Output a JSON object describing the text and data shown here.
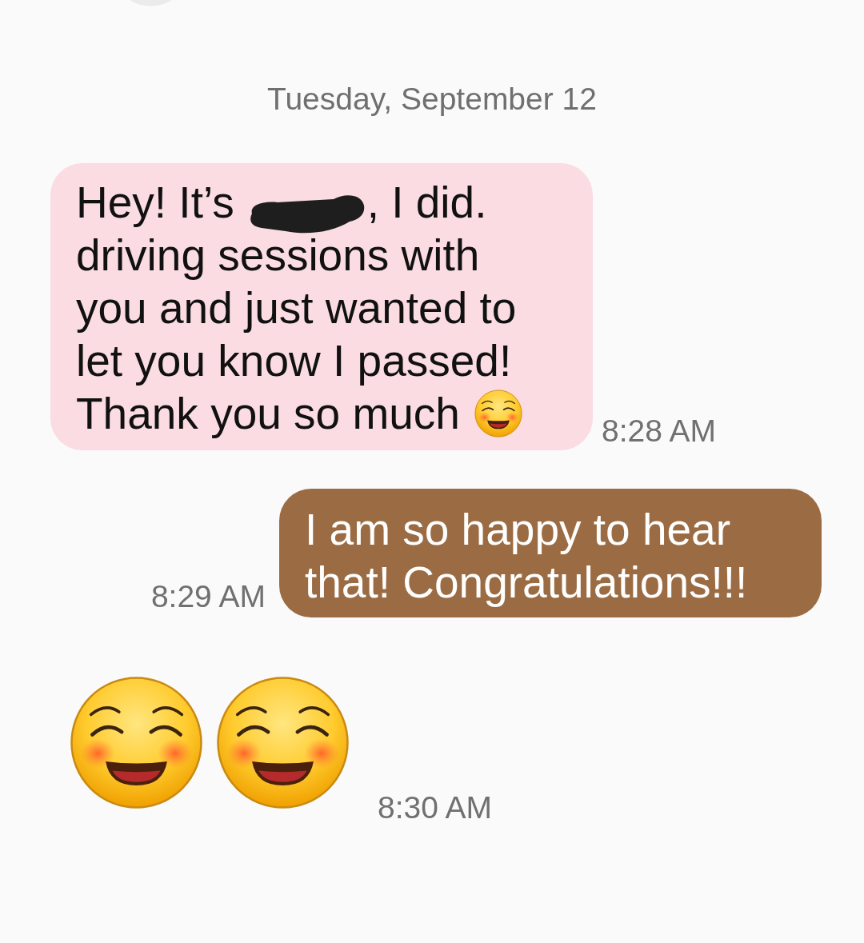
{
  "conversation": {
    "date_header": "Tuesday, September 12",
    "messages": [
      {
        "kind": "text",
        "sent": false,
        "before_redaction": "Hey! It’s",
        "redacted": true,
        "text": ", I did. driving sessions with you and just wanted to let you know I passed! Thank you so much",
        "trailing_emoji": true,
        "time": "8:28 AM"
      },
      {
        "kind": "text",
        "sent": true,
        "text": "I am so happy to hear that! Congratulations!!!",
        "time": "8:29 AM"
      },
      {
        "kind": "emoji",
        "sent": false,
        "emojis": [
          {
            "kind": "smile"
          },
          {
            "kind": "smile"
          }
        ],
        "time": "8:30 AM"
      }
    ]
  }
}
